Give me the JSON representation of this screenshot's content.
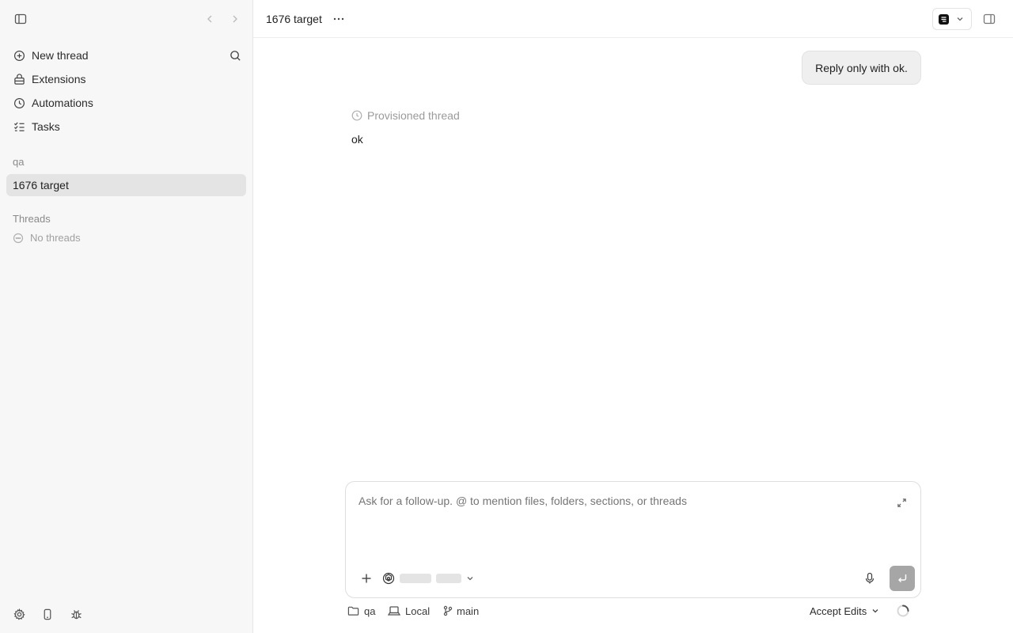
{
  "sidebar": {
    "nav": [
      {
        "label": "New thread",
        "icon": "plus-circle-icon"
      },
      {
        "label": "Extensions",
        "icon": "extensions-icon"
      },
      {
        "label": "Automations",
        "icon": "clock-icon"
      },
      {
        "label": "Tasks",
        "icon": "checklist-icon"
      }
    ],
    "project_label": "qa",
    "active_thread": "1676 target",
    "threads_label": "Threads",
    "empty_threads": "No threads"
  },
  "header": {
    "title": "1676 target"
  },
  "conversation": {
    "user_message": "Reply only with ok.",
    "status_label": "Provisioned thread",
    "assistant_reply": "ok"
  },
  "composer": {
    "placeholder": "Ask for a follow-up. @ to mention files, folders, sections, or threads"
  },
  "footer": {
    "folder": "qa",
    "environment": "Local",
    "branch": "main",
    "mode": "Accept Edits"
  },
  "colors": {
    "sidebar_bg": "#f7f7f7",
    "active_item_bg": "#e4e4e4",
    "send_button": "#a6a6a6"
  }
}
